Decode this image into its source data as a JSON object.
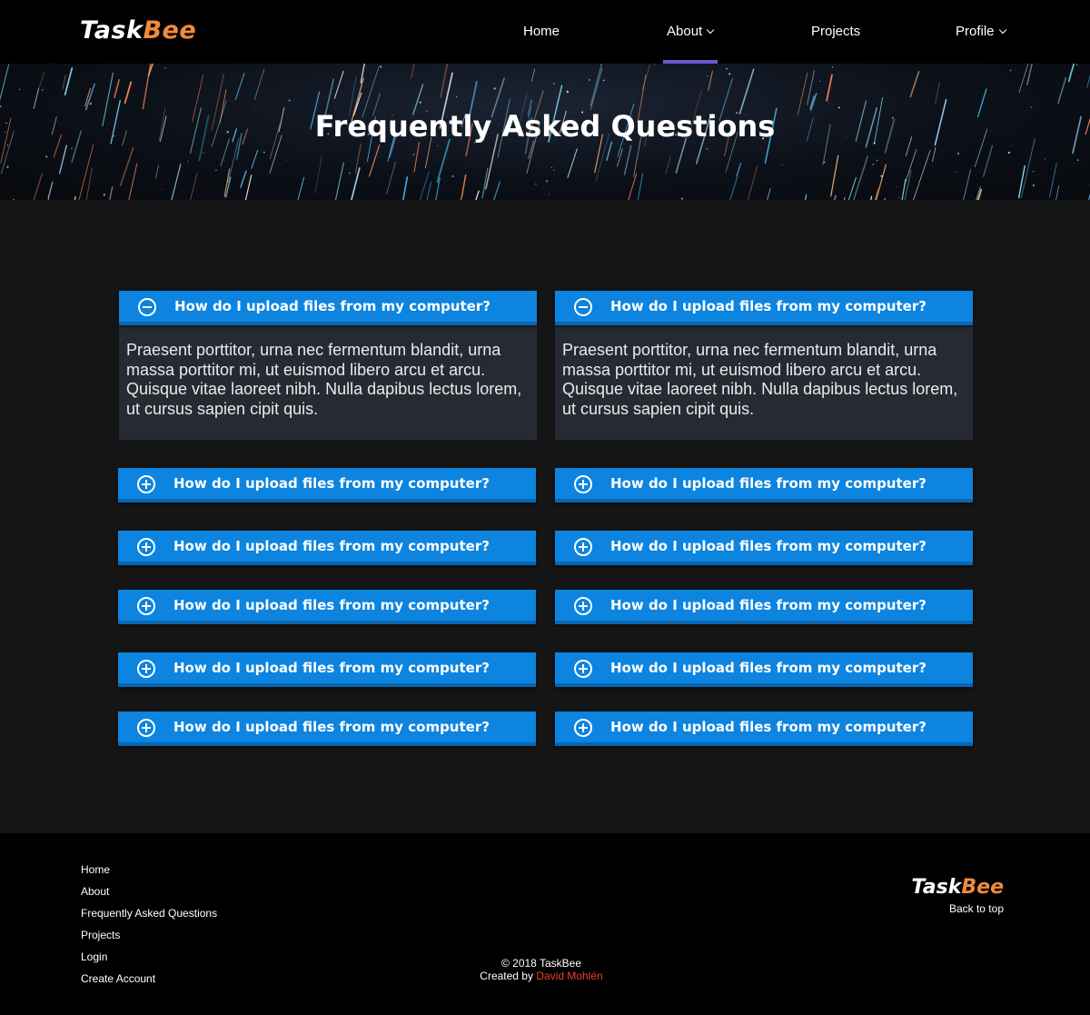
{
  "brand": {
    "part1": "Task",
    "part2": "Bee"
  },
  "nav": {
    "home": "Home",
    "about": "About",
    "projects": "Projects",
    "profile": "Profile"
  },
  "hero": {
    "title": "Frequently Asked Questions"
  },
  "faq": {
    "question": "How do I upload files from my computer?",
    "answer": "Praesent porttitor, urna nec fermentum blandit, urna massa porttitor mi, ut euismod libero arcu et arcu. Quisque vitae laoreet nibh. Nulla dapibus lectus lorem, ut cursus sapien cipit quis.",
    "items": [
      {
        "question": "How do I upload files from my computer?",
        "answer": "Praesent porttitor, urna nec fermentum blandit, urna massa porttitor mi, ut euismod libero arcu et arcu. Quisque vitae laoreet nibh. Nulla dapibus lectus lorem, ut cursus sapien cipit quis.",
        "expanded": true
      },
      {
        "question": "How do I upload files from my computer?",
        "answer": "Praesent porttitor, urna nec fermentum blandit, urna massa porttitor mi, ut euismod libero arcu et arcu. Quisque vitae laoreet nibh. Nulla dapibus lectus lorem, ut cursus sapien cipit quis.",
        "expanded": true
      },
      {
        "question": "How do I upload files from my computer?",
        "expanded": false
      },
      {
        "question": "How do I upload files from my computer?",
        "expanded": false
      },
      {
        "question": "How do I upload files from my computer?",
        "expanded": false
      },
      {
        "question": "How do I upload files from my computer?",
        "expanded": false
      },
      {
        "question": "How do I upload files from my computer?",
        "expanded": false
      },
      {
        "question": "How do I upload files from my computer?",
        "expanded": false
      },
      {
        "question": "How do I upload files from my computer?",
        "expanded": false
      },
      {
        "question": "How do I upload files from my computer?",
        "expanded": false
      },
      {
        "question": "How do I upload files from my computer?",
        "expanded": false
      },
      {
        "question": "How do I upload files from my computer?",
        "expanded": false
      }
    ]
  },
  "footer": {
    "links": [
      "Home",
      "About",
      "Frequently Asked Questions",
      "Projects",
      "Login",
      "Create Account"
    ],
    "back_to_top": "Back to top",
    "copyright": "© 2018 TaskBee",
    "created_by": "Created by ",
    "author": "David Mohlén"
  },
  "colors": {
    "accent_blue": "#0d84df",
    "brand_orange": "#f08a3c",
    "nav_underline": "#6a5acd",
    "author_red": "#e8402a"
  }
}
